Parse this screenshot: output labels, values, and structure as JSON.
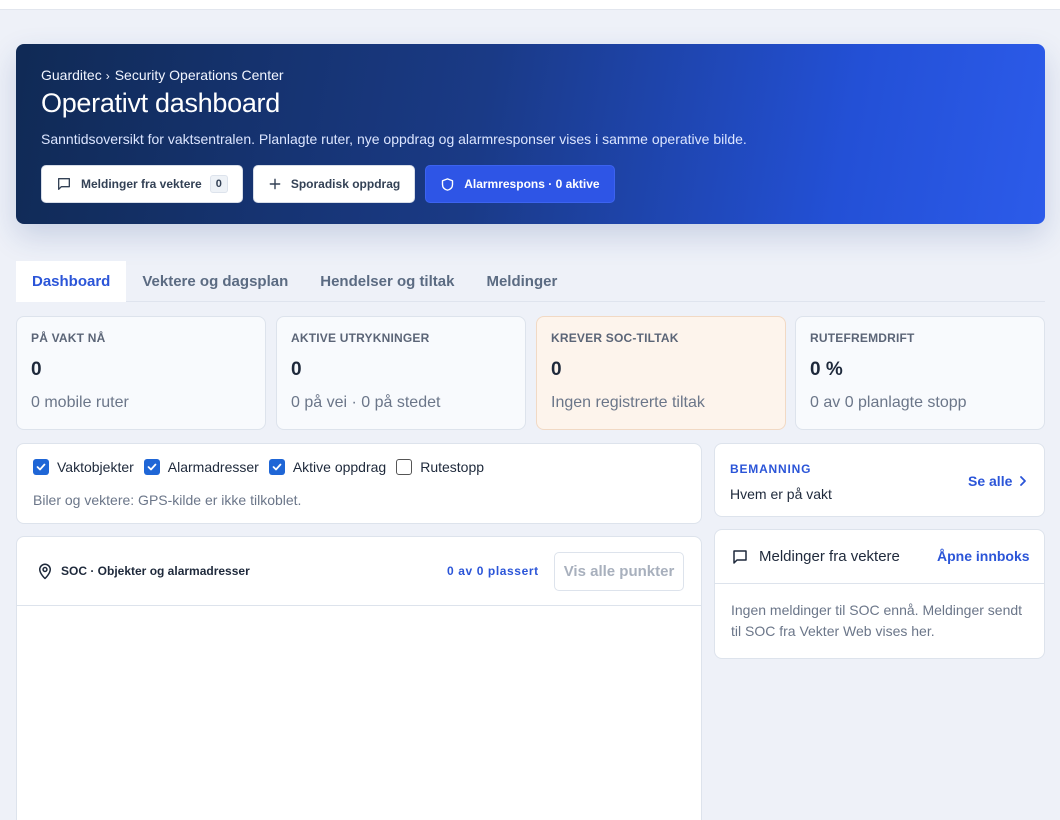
{
  "hero": {
    "brand": "Guarditec",
    "breadcrumb_page": "Security Operations Center",
    "title": "Operativt dashboard",
    "subtitle": "Sanntidsoversikt for vaktsentralen. Planlagte ruter, nye oppdrag og alarmresponser vises i samme operative bilde.",
    "actions": {
      "messages_label": "Meldinger fra vektere",
      "messages_count": "0",
      "sporadic_label": "Sporadisk oppdrag",
      "alarm_label": "Alarmrespons · 0 aktive"
    }
  },
  "tabs": [
    {
      "label": "Dashboard",
      "active": true
    },
    {
      "label": "Vektere og dagsplan",
      "active": false
    },
    {
      "label": "Hendelser og tiltak",
      "active": false
    },
    {
      "label": "Meldinger",
      "active": false
    }
  ],
  "stats": [
    {
      "label": "PÅ VAKT NÅ",
      "value": "0",
      "detail": "0 mobile ruter"
    },
    {
      "label": "AKTIVE UTRYKNINGER",
      "value": "0",
      "detail": "0 på vei · 0 på stedet"
    },
    {
      "label": "KREVER SOC-TILTAK",
      "value": "0",
      "detail": "Ingen registrerte tiltak"
    },
    {
      "label": "RUTEFREMDRIFT",
      "value": "0 %",
      "detail": "0 av 0 planlagte stopp"
    }
  ],
  "filters": {
    "items": [
      {
        "label": "Vaktobjekter",
        "checked": true
      },
      {
        "label": "Alarmadresser",
        "checked": true
      },
      {
        "label": "Aktive oppdrag",
        "checked": true
      },
      {
        "label": "Rutestopp",
        "checked": false
      }
    ],
    "note": "Biler og vektere: GPS-kilde er ikke tilkoblet."
  },
  "map": {
    "title": "SOC · Objekter og alarmadresser",
    "placed": "0 av 0 plassert",
    "show_all": "Vis alle punkter"
  },
  "staffing": {
    "kicker": "BEMANNING",
    "subtitle": "Hvem er på vakt",
    "see_all": "Se alle"
  },
  "messages": {
    "title": "Meldinger fra vektere",
    "open_inbox": "Åpne innboks",
    "empty": "Ingen meldinger til SOC ennå. Meldinger sendt til SOC fra Vekter Web vises her."
  },
  "colors": {
    "accent": "#2b55d8",
    "hero_start": "#102a55",
    "hero_end": "#2c5bea",
    "warn_bg": "#fdf4ec",
    "checkbox": "#1f66d6"
  }
}
